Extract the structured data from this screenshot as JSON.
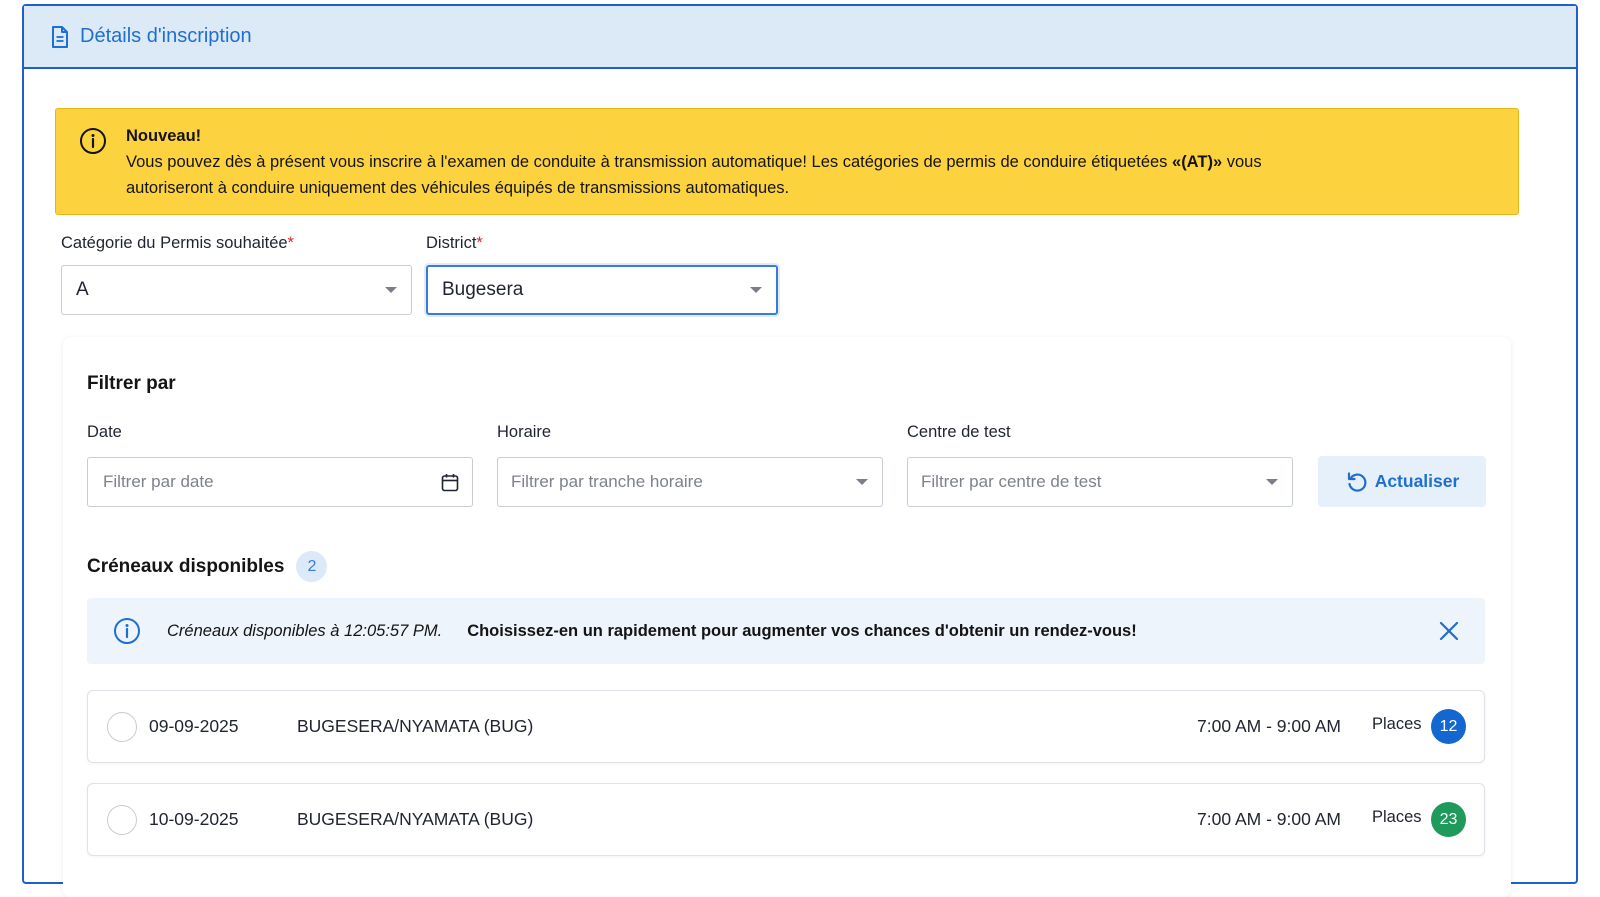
{
  "header": {
    "title": "Détails d'inscription",
    "icon": "document-icon"
  },
  "notice": {
    "icon": "info-icon",
    "title": "Nouveau!",
    "line1_prefix": "Vous pouvez dès à présent vous inscrire à l'examen de conduite à transmission automatique! Les catégories de permis de conduire étiquetées ",
    "line1_bold": "«(AT)»",
    "line1_suffix": " vous",
    "line2": "autoriseront à conduire uniquement des véhicules équipés de transmissions automatiques.",
    "background_color": "#fdd23f"
  },
  "form": {
    "category": {
      "label": "Catégorie du Permis souhaitée",
      "required_mark": "*",
      "value": "A"
    },
    "district": {
      "label": "District",
      "required_mark": "*",
      "value": "Bugesera"
    }
  },
  "filters": {
    "title": "Filtrer par",
    "date": {
      "label": "Date",
      "placeholder": "Filtrer par date",
      "icon": "calendar-icon"
    },
    "schedule": {
      "label": "Horaire",
      "placeholder": "Filtrer par tranche horaire"
    },
    "center": {
      "label": "Centre de test",
      "placeholder": "Filtrer par centre de test"
    },
    "refresh_label": "Actualiser",
    "refresh_icon": "refresh-icon"
  },
  "slots": {
    "title": "Créneaux disponibles",
    "count": "2",
    "alert": {
      "icon": "info-icon",
      "time_text": "Créneaux disponibles à 12:05:57 PM.",
      "message": "Choisissez-en un rapidement pour augmenter vos chances d'obtenir un rendez-vous!",
      "close_icon": "close-icon"
    },
    "places_label": "Places",
    "items": [
      {
        "date": "09-09-2025",
        "center": "BUGESERA/NYAMATA (BUG)",
        "time": "7:00 AM - 9:00 AM",
        "places": "12",
        "badge_color": "#1466d1"
      },
      {
        "date": "10-09-2025",
        "center": "BUGESERA/NYAMATA (BUG)",
        "time": "7:00 AM - 9:00 AM",
        "places": "23",
        "badge_color": "#1e9a5b"
      }
    ]
  },
  "colors": {
    "accent": "#1f6fd0",
    "required": "#e02424"
  }
}
